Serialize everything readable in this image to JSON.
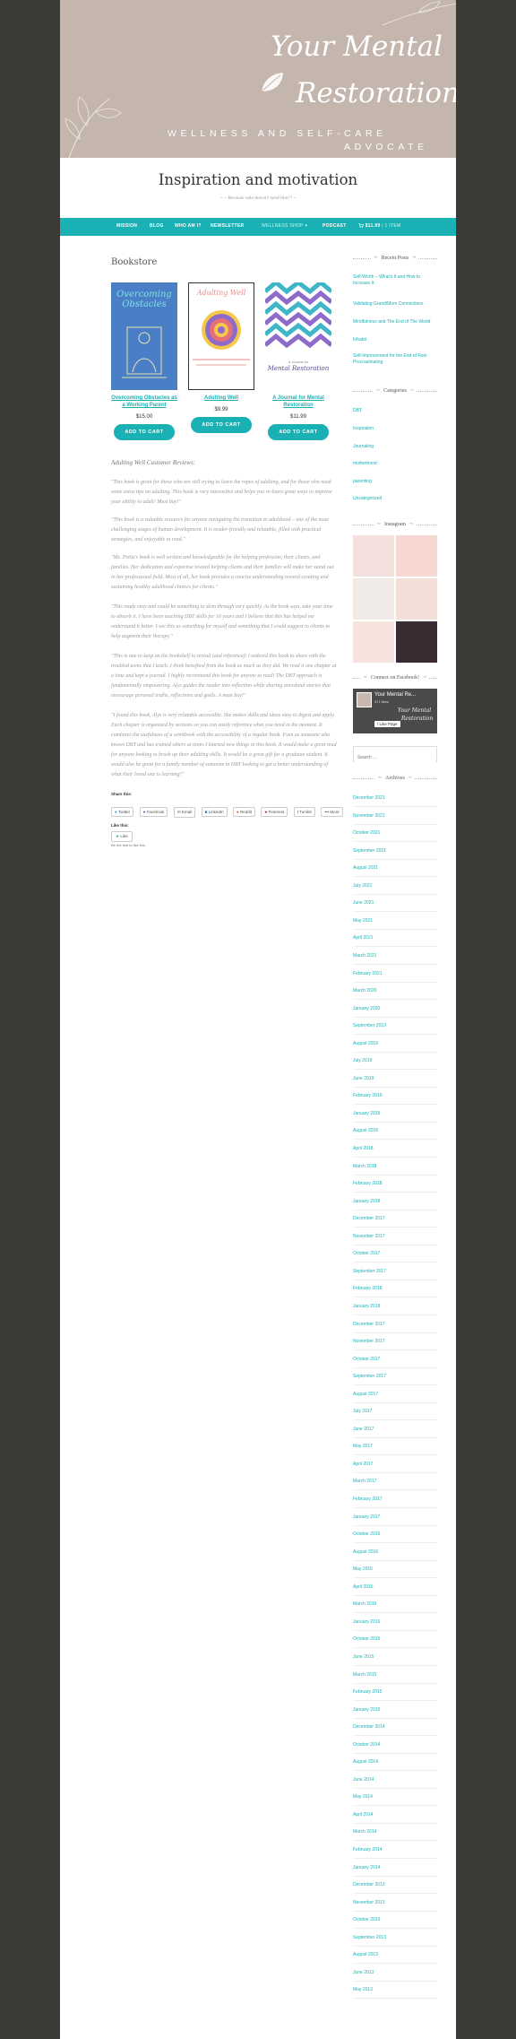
{
  "header": {
    "brand_line1": "Your Mental",
    "brand_line2": "Restoration",
    "brand_sub1": "WELLNESS AND SELF-CARE",
    "brand_sub2": "ADVOCATE",
    "site_title": "Inspiration and motivation",
    "site_description": "~ ~ Because who doesn't need that!? ~"
  },
  "nav": {
    "items": [
      "MISSION",
      "BLOG",
      "WHO AM I?",
      "NEWSLETTER",
      "WELLNESS SHOP",
      "PODCAST",
      "$11.99",
      "1 ITEM"
    ],
    "shop_chevron": "▾"
  },
  "main": {
    "title": "Bookstore",
    "products": [
      {
        "name": "Overcoming Obstacles as a Working Parent",
        "price": "$15.00",
        "button": "ADD TO CART",
        "cover_title1": "Overcoming",
        "cover_title2": "Obstacles"
      },
      {
        "name": "Adulting Well",
        "price": "$9.99",
        "button": "ADD TO CART",
        "cover_title1": "Adulting Well"
      },
      {
        "name": "A Journal for Mental Restoration",
        "price": "$11.99",
        "button": "ADD TO CART",
        "cover_title1": "A Journal for",
        "cover_title2": "Mental Restoration"
      }
    ],
    "reviews_heading": "Adulting Well Customer Reviews:",
    "reviews": [
      "\"This book is great for those who are still trying to learn the ropes of adulting, and for those who need some extra tips on adulting. This book is very interactive and helps you re-learn great ways to improve your ability to adult! Must buy!\"",
      "\"This book is a valuable resource for anyone navigating the transition to adulthood – one of the most challenging stages of human development. It is reader-friendly and relatable, filled with practical strategies, and enjoyable to read.\"",
      "\"Ms. Pettiz's book is well written and knowledgeable for the helping profession, their clients, and families. Her dedication and expertise toward helping clients and their families will make her stand out in her professional field. Most of all, her book provides a concise understanding toward creating and sustaining healthy adulthood choices for clients.\"",
      "\"This reads easy and could be something to skim through very quickly. As the book says, take your time to absorb it. I have been teaching DBT skills for 10 years and I believe that this has helped me understand it better. I see this as something for myself and something that I could suggest to clients to help augment their therapy.\"",
      "\"This is one to keep on the bookshelf to reread (and reference)! I ordered this book to share with the troubled teens that I teach. I think benefited from the book as much as they did. We read it one chapter at a time and kept a journal. I highly recommend this book for anyone to read! The DBT approach is fundamentally empowering. Alys guides the reader into reflection while sharing anecdotal stories that encourage personal truths, reflections and goals. A must buy!\"",
      "\"I found this book, Alys is very relatable accessible. She makes skills and ideas easy to digest and apply. Each chapter is organized by sections so you can easily reference what you need in the moment. It combines the usefulness of a workbook with the accessibility of a regular book. Even as someone who knows DBT and has trained others at times I learned new things in this book. It would make a great read for anyone looking to brush up their adulting skills. It would be a great gift for a graduate student. It would also be great for a family member of someone in DBT looking to get a better understanding of what their loved one is learning!\""
    ],
    "share_label": "Share this:",
    "share_buttons": [
      "Twitter",
      "Facebook",
      "Email",
      "LinkedIn",
      "Reddit",
      "Pinterest",
      "Tumblr",
      "More"
    ],
    "like_label": "Like this:",
    "like_button": "Like",
    "like_first": "Be the first to like this."
  },
  "sidebar": {
    "recent_heading": "Recent Posts",
    "recent_posts": [
      "Self-Worth – What's It and How to Increase It",
      "Validating Grand/Mom Connections",
      "Mindfulness and The End of The World",
      "Inhabit",
      "Self-Improvement for the End of Rain Procrastinating"
    ],
    "categories_heading": "Categories",
    "categories": [
      "DBT",
      "Inspiration",
      "Journaling",
      "motherhood",
      "parenting",
      "Uncategorized"
    ],
    "instagram_heading": "Instagram",
    "facebook_heading": "Connect on Facebook!",
    "facebook": {
      "title": "Your Mental Re...",
      "count": "371 likes",
      "like": "Like Page",
      "script1": "Your Mental",
      "script2": "Restoration"
    },
    "search_placeholder": "Search …",
    "archives_heading": "Archives",
    "archives": [
      "December 2021",
      "November 2021",
      "October 2021",
      "September 2021",
      "August 2021",
      "July 2021",
      "June 2021",
      "May 2021",
      "April 2021",
      "March 2021",
      "February 2021",
      "March 2020",
      "January 2020",
      "September 2019",
      "August 2019",
      "July 2019",
      "June 2019",
      "February 2019",
      "January 2019",
      "August 2018",
      "April 2018",
      "March 2018",
      "February 2018",
      "January 2018",
      "December 2017",
      "November 2017",
      "October 2017",
      "September 2017",
      "February 2018",
      "January 2018",
      "December 2017",
      "November 2017",
      "October 2017",
      "September 2017",
      "August 2017",
      "July 2017",
      "June 2017",
      "May 2017",
      "April 2017",
      "March 2017",
      "February 2017",
      "January 2017",
      "October 2016",
      "August 2016",
      "May 2016",
      "April 2016",
      "March 2016",
      "January 2016",
      "October 2015",
      "June 2015",
      "March 2015",
      "February 2015",
      "January 2015",
      "December 2014",
      "October 2014",
      "August 2014",
      "June 2014",
      "May 2014",
      "April 2014",
      "March 2014",
      "February 2014",
      "January 2014",
      "December 2013",
      "November 2013",
      "October 2013",
      "September 2013",
      "August 2013",
      "June 2013",
      "May 2013"
    ]
  },
  "colors": {
    "accent": "#1ab1b5",
    "banner": "#c4b5ad",
    "outer": "#3b3a37"
  }
}
